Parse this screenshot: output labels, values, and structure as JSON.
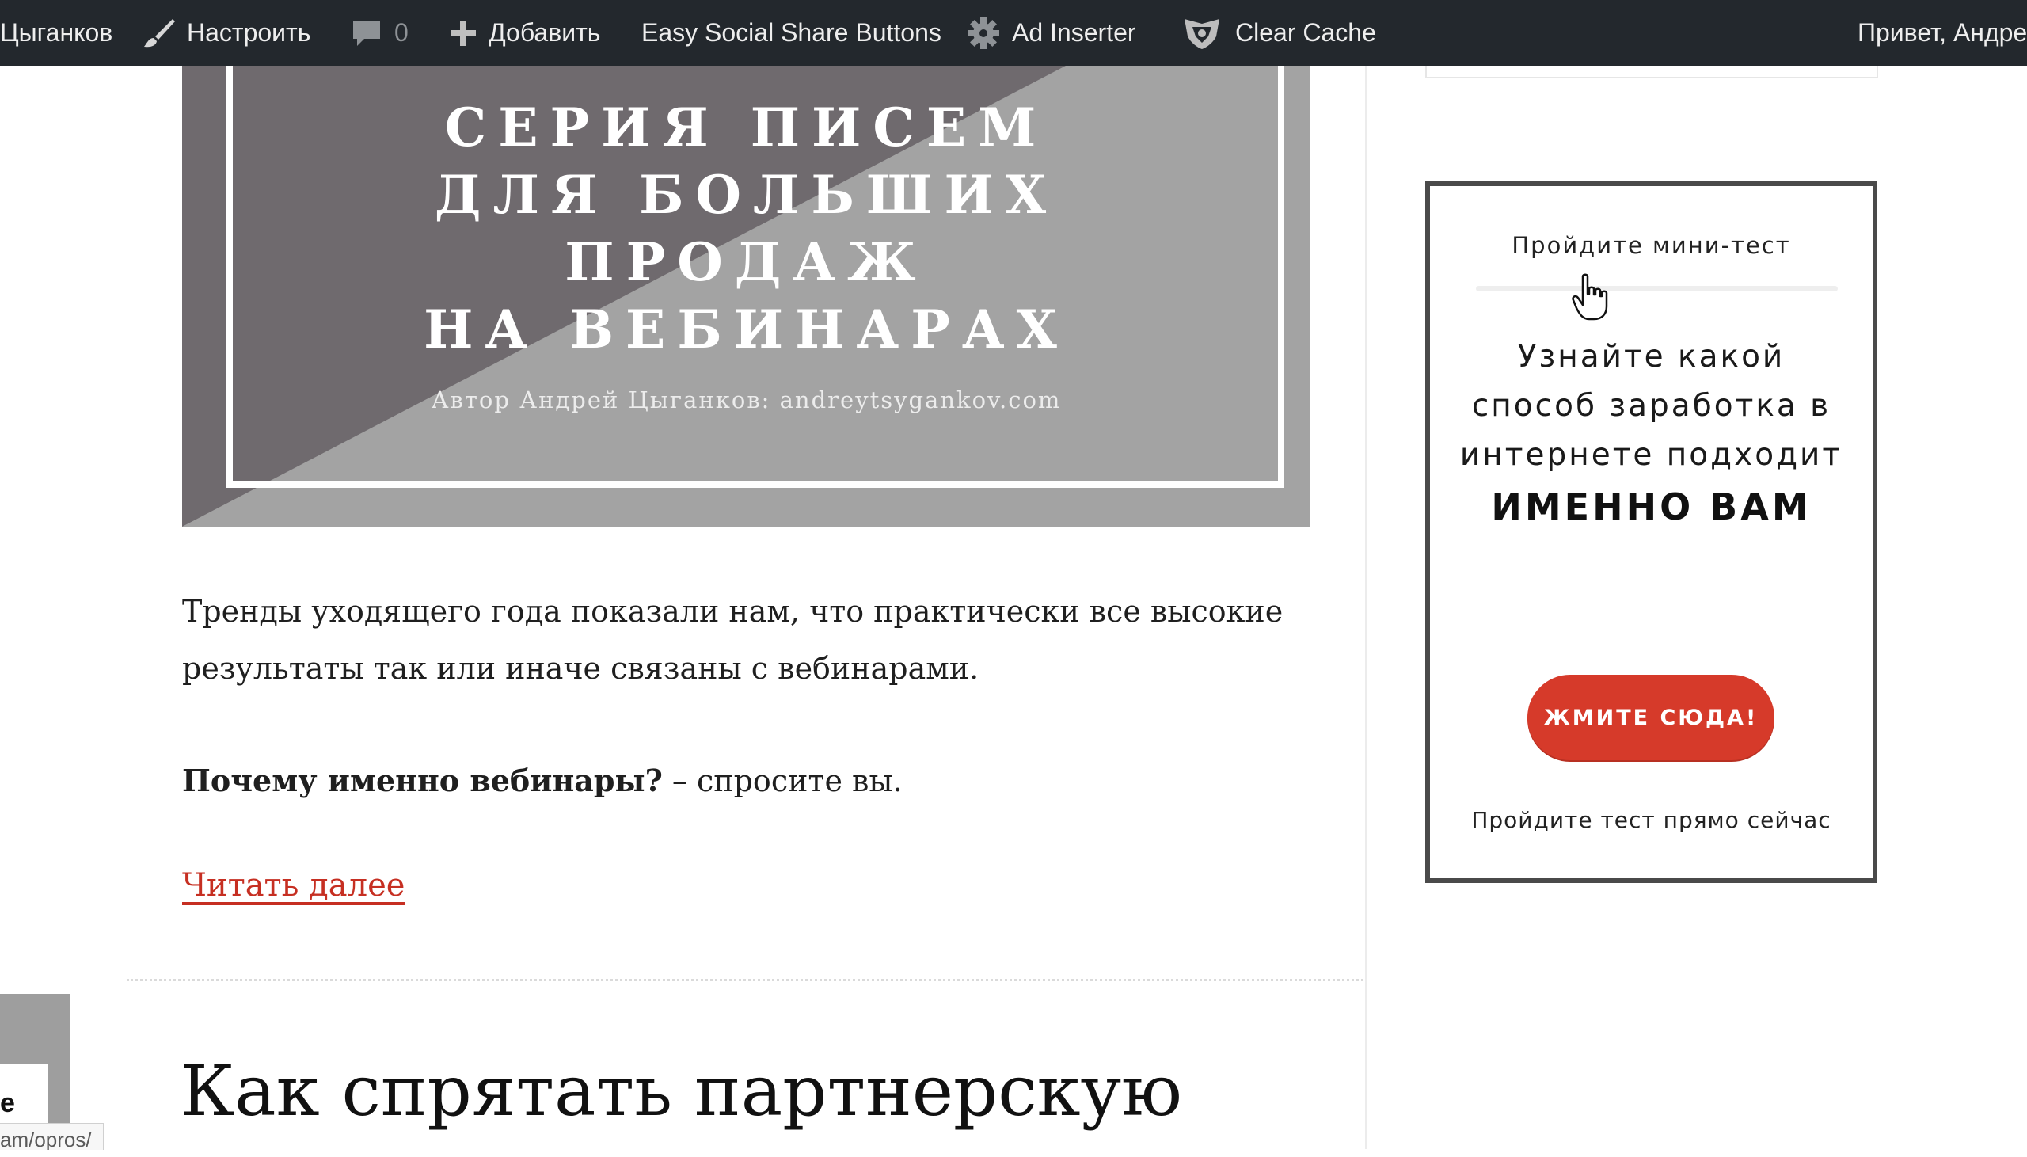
{
  "admin_bar": {
    "site_name": "Цыганков",
    "customize_label": "Настроить",
    "comments_count": "0",
    "add_new_label": "Добавить",
    "essb_label": "Easy Social Share Buttons",
    "ad_inserter_label": "Ad Inserter",
    "clear_cache_label": "Clear Cache",
    "greeting": "Привет, Андре",
    "icons": [
      "paintbrush-icon",
      "comment-bubble-icon",
      "plus-icon",
      "gear-icon",
      "cache-shield-icon"
    ]
  },
  "featured_image": {
    "headline_lines": [
      "СЕРИЯ ПИСЕМ",
      "ДЛЯ БОЛЬШИХ",
      "ПРОДАЖ",
      "НА ВЕБИНАРАХ"
    ],
    "author_line": "Автор Андрей Цыганков: andreytsygankov.com",
    "colors": {
      "dark": "#6f6a6e",
      "light": "#a3a3a3"
    }
  },
  "post": {
    "excerpt_line1": "Тренды уходящего года показали нам, что практически все высокие",
    "excerpt_line2": "результаты так или иначе связаны с вебинарами.",
    "question_bold": "Почему именно вебинары?",
    "question_rest": " – спросите вы.",
    "read_more": "Читать далее",
    "link_color": "#c62f22"
  },
  "next_post": {
    "title": "Как спрятать партнерскую"
  },
  "thumbnail": {
    "letter": "е"
  },
  "status_bar": {
    "url": "am/opros/"
  },
  "quiz_widget": {
    "kicker": "Пройдите мини-тест",
    "lead_lines": [
      "Узнайте какой",
      "способ заработка в",
      "интернете подходит"
    ],
    "emphasis": "ИМЕННО ВАМ",
    "cta_label": "ЖМИТЕ СЮДА!",
    "footer": "Пройдите тест прямо сейчас",
    "cta_color": "#d63a2a"
  }
}
